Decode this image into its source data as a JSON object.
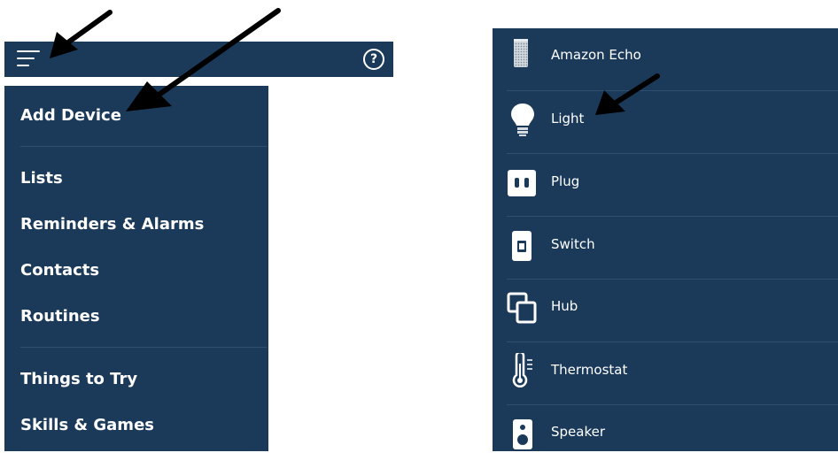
{
  "topbar": {
    "menu_icon": "hamburger-menu-icon",
    "help_icon": "help-circle-icon",
    "help_glyph": "?"
  },
  "menu": {
    "items": [
      {
        "label": "Add Device"
      },
      {
        "label": "Lists"
      },
      {
        "label": "Reminders & Alarms"
      },
      {
        "label": "Contacts"
      },
      {
        "label": "Routines"
      },
      {
        "label": "Things to Try"
      },
      {
        "label": "Skills & Games"
      }
    ]
  },
  "devices": {
    "items": [
      {
        "label": "Amazon Echo",
        "icon": "amazon-echo-icon"
      },
      {
        "label": "Light",
        "icon": "light-bulb-icon"
      },
      {
        "label": "Plug",
        "icon": "plug-icon"
      },
      {
        "label": "Switch",
        "icon": "switch-icon"
      },
      {
        "label": "Hub",
        "icon": "hub-icon"
      },
      {
        "label": "Thermostat",
        "icon": "thermostat-icon"
      },
      {
        "label": "Speaker",
        "icon": "speaker-icon"
      }
    ]
  },
  "colors": {
    "panel": "#1b3a5a",
    "divider": "#2e4f70",
    "text": "#ffffff",
    "arrow": "#000000"
  },
  "annotations": {
    "arrow_icon": "pointer-arrow-icon"
  }
}
